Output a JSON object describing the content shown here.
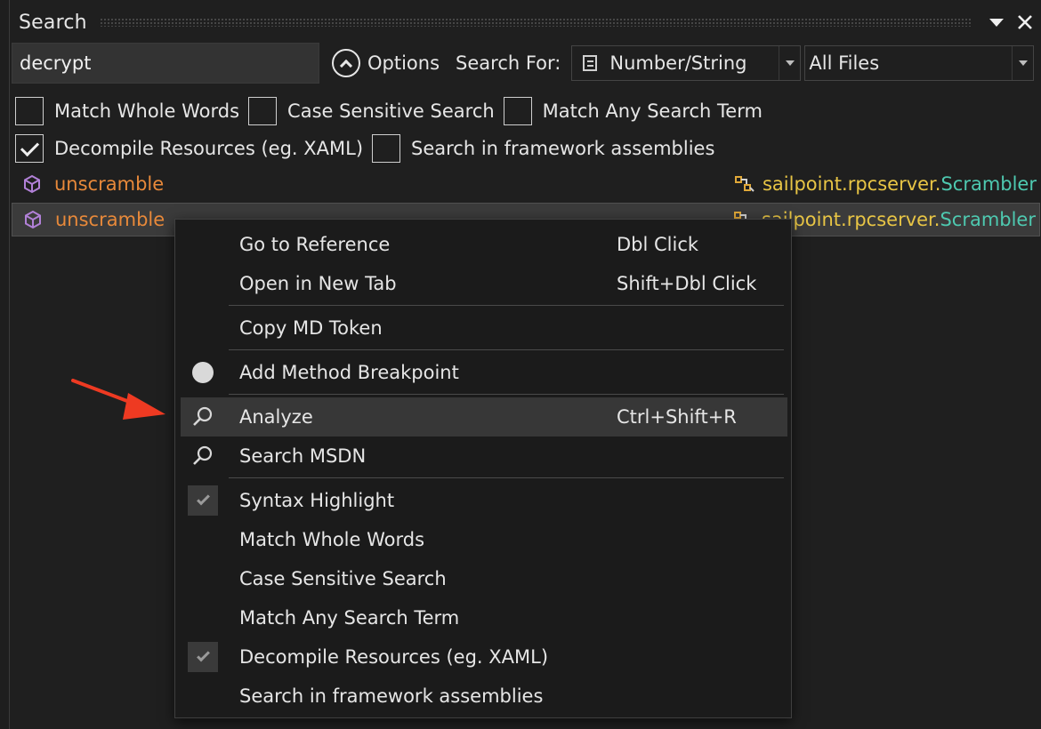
{
  "panel": {
    "title": "Search",
    "dropdown_icon": "dropdown-arrow",
    "close_icon": "close-x"
  },
  "search": {
    "value": "decrypt",
    "options_label": "Options",
    "search_for_label": "Search For:",
    "type_combo_value": "Number/String",
    "scope_combo_value": "All Files"
  },
  "options": {
    "row1": [
      {
        "label": "Match Whole Words",
        "checked": false
      },
      {
        "label": "Case Sensitive Search",
        "checked": false
      },
      {
        "label": "Match Any Search Term",
        "checked": false
      }
    ],
    "row2": [
      {
        "label": "Decompile Resources (eg. XAML)",
        "checked": true
      },
      {
        "label": "Search in framework assemblies",
        "checked": false
      }
    ]
  },
  "results": [
    {
      "method": "unscramble",
      "namespace": "sailpoint.rpcserver.",
      "class": "Scrambler",
      "selected": false
    },
    {
      "method": "unscramble",
      "namespace": "sailpoint.rpcserver.",
      "class": "Scrambler",
      "selected": true
    }
  ],
  "context_menu": {
    "items": [
      {
        "label": "Go to Reference",
        "shortcut": "Dbl Click"
      },
      {
        "label": "Open in New Tab",
        "shortcut": "Shift+Dbl Click"
      },
      {
        "label": "Copy MD Token",
        "shortcut": ""
      },
      {
        "label": "Add Method Breakpoint",
        "shortcut": "",
        "icon": "breakpoint-dot"
      },
      {
        "label": "Analyze",
        "shortcut": "Ctrl+Shift+R",
        "icon": "magnifier",
        "highlighted": true
      },
      {
        "label": "Search MSDN",
        "shortcut": "",
        "icon": "magnifier"
      },
      {
        "label": "Syntax Highlight",
        "shortcut": "",
        "checked": true
      },
      {
        "label": "Match Whole Words",
        "shortcut": ""
      },
      {
        "label": "Case Sensitive Search",
        "shortcut": ""
      },
      {
        "label": "Match Any Search Term",
        "shortcut": ""
      },
      {
        "label": "Decompile Resources (eg. XAML)",
        "shortcut": "",
        "checked": true
      },
      {
        "label": "Search in framework assemblies",
        "shortcut": ""
      }
    ]
  },
  "colors": {
    "background": "#1f1f1f",
    "method": "#e8893a",
    "namespace": "#e8c545",
    "class": "#4ec9b0",
    "method_icon": "#b180d7",
    "annotation_arrow": "#ee3a22"
  }
}
